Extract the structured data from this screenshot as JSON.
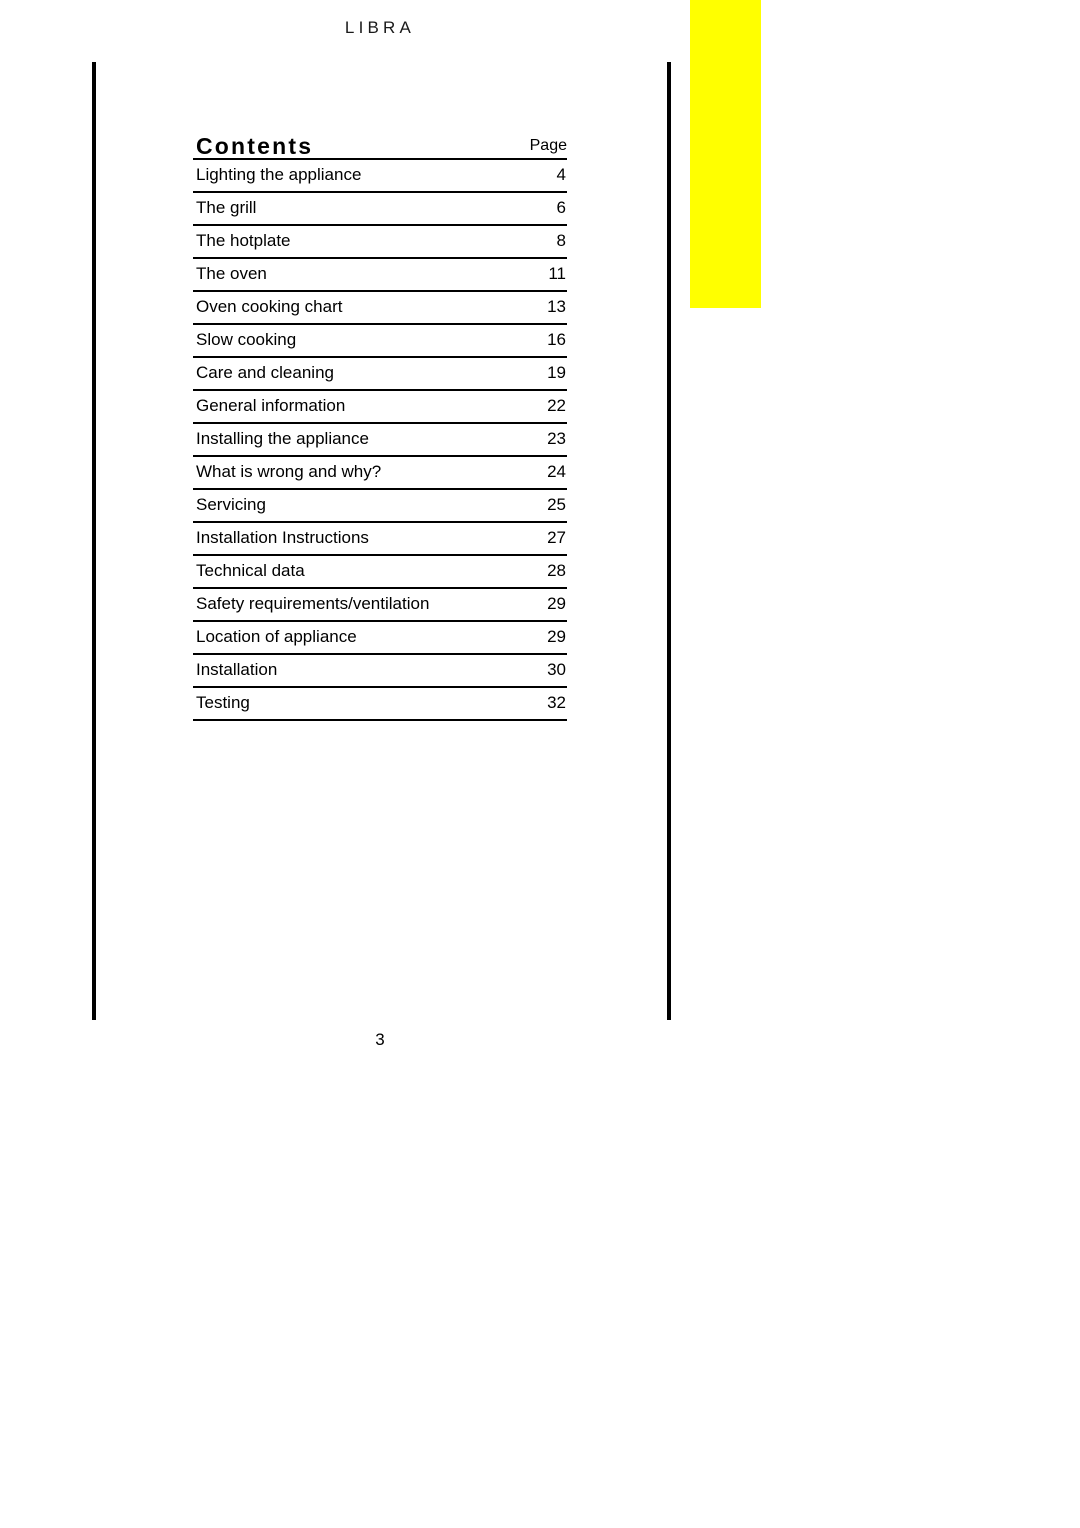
{
  "page": {
    "running_head": "LIBRA",
    "folio": "3",
    "background_color": "#ffffff",
    "text_color": "#000000",
    "rule_color": "#000000"
  },
  "marker": {
    "name": "yellow-highlight-block",
    "color": "#ffff00"
  },
  "contents": {
    "title": "Contents",
    "page_column_label": "Page",
    "entries": [
      {
        "label": "Lighting the appliance",
        "page": "4"
      },
      {
        "label": "The grill",
        "page": "6"
      },
      {
        "label": "The hotplate",
        "page": "8"
      },
      {
        "label": "The oven",
        "page": "11"
      },
      {
        "label": "Oven cooking chart",
        "page": "13"
      },
      {
        "label": "Slow cooking",
        "page": "16"
      },
      {
        "label": "Care and cleaning",
        "page": "19"
      },
      {
        "label": "General information",
        "page": "22"
      },
      {
        "label": "Installing the appliance",
        "page": "23"
      },
      {
        "label": "What is wrong and why?",
        "page": "24"
      },
      {
        "label": "Servicing",
        "page": "25"
      },
      {
        "label": "Installation Instructions",
        "page": "27"
      },
      {
        "label": "Technical data",
        "page": "28"
      },
      {
        "label": "Safety requirements/ventilation",
        "page": "29"
      },
      {
        "label": "Location of appliance",
        "page": "29"
      },
      {
        "label": "Installation",
        "page": "30"
      },
      {
        "label": "Testing",
        "page": "32"
      }
    ]
  }
}
